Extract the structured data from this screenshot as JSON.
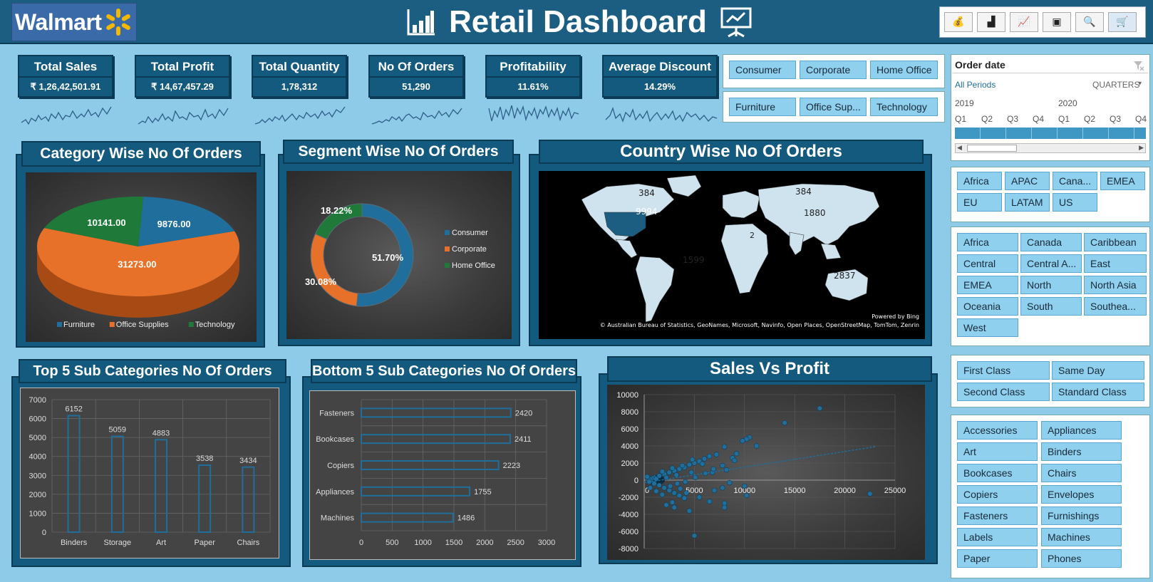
{
  "header": {
    "logo_text": "Walmart",
    "title": "Retail Dashboard",
    "toolbar": [
      "money-bag-icon",
      "chart-icon",
      "line-chart-icon",
      "box-icon",
      "search-icon",
      "cart-icon"
    ]
  },
  "kpis": [
    {
      "title": "Total Sales",
      "value": "₹ 1,26,42,501.91"
    },
    {
      "title": "Total Profit",
      "value": "₹ 14,67,457.29"
    },
    {
      "title": "Total Quantity",
      "value": "1,78,312"
    },
    {
      "title": "No Of Orders",
      "value": "51,290"
    },
    {
      "title": "Profitability",
      "value": "11.61%"
    },
    {
      "title": "Average Discount",
      "value": "14.29%"
    }
  ],
  "segment_slicer": [
    "Consumer",
    "Corporate",
    "Home Office"
  ],
  "category_slicer": [
    "Furniture",
    "Office Sup...",
    "Technology"
  ],
  "timeline": {
    "title": "Order date",
    "all_periods": "All Periods",
    "level": "QUARTERS",
    "years": [
      "2019",
      "2020"
    ],
    "quarters": [
      "Q1",
      "Q2",
      "Q3",
      "Q4",
      "Q1",
      "Q2",
      "Q3",
      "Q4"
    ]
  },
  "market_slicer": [
    "Africa",
    "APAC",
    "Cana...",
    "EMEA",
    "EU",
    "LATAM",
    "US"
  ],
  "region_slicer": [
    "Africa",
    "Canada",
    "Caribbean",
    "Central",
    "Central A...",
    "East",
    "EMEA",
    "North",
    "North Asia",
    "Oceania",
    "South",
    "Southea...",
    "West"
  ],
  "ship_slicer": [
    "First Class",
    "Same Day",
    "Second Class",
    "Standard Class"
  ],
  "subcat_slicer": [
    "Accessories",
    "Appliances",
    "Art",
    "Binders",
    "Bookcases",
    "Chairs",
    "Copiers",
    "Envelopes",
    "Fasteners",
    "Furnishings",
    "Labels",
    "Machines",
    "Paper",
    "Phones"
  ],
  "colors": {
    "furniture": "#1f6e9c",
    "office": "#e8712a",
    "technology": "#1f7a3a",
    "accent": "#135a7e",
    "bar": "#1f6e9c"
  },
  "chart_data": [
    {
      "type": "pie",
      "title": "Category Wise No Of Orders",
      "categories": [
        "Furniture",
        "Office Supplies",
        "Technology"
      ],
      "values": [
        9876,
        31273,
        10141
      ],
      "labels": [
        "9876.00",
        "31273.00",
        "10141.00"
      ],
      "legend": "bottom"
    },
    {
      "type": "pie",
      "title": "Segment Wise No Of Orders",
      "categories": [
        "Consumer",
        "Corporate",
        "Home Office"
      ],
      "values": [
        51.7,
        30.08,
        18.22
      ],
      "labels": [
        "51.70%",
        "30.08%",
        "18.22%"
      ],
      "legend": "right"
    },
    {
      "type": "map",
      "title": "Country Wise No Of Orders",
      "labels": [
        "384",
        "9994",
        "384",
        "1880",
        "1599",
        "2837",
        "2"
      ],
      "attribution": "© Australian Bureau of Statistics, GeoNames, Microsoft, Navinfo, Open Places, OpenStreetMap, TomTom, Zenrin",
      "powered": "Powered by Bing"
    },
    {
      "type": "bar",
      "title": "Top 5 Sub Categories No Of Orders",
      "categories": [
        "Binders",
        "Storage",
        "Art",
        "Paper",
        "Chairs"
      ],
      "values": [
        6152,
        5059,
        4883,
        3538,
        3434
      ],
      "ylim": [
        0,
        7000
      ],
      "yticks": [
        0,
        1000,
        2000,
        3000,
        4000,
        5000,
        6000,
        7000
      ],
      "grid": true
    },
    {
      "type": "bar",
      "orientation": "horizontal",
      "title": "Bottom 5 Sub Categories No Of Orders",
      "categories": [
        "Fasteners",
        "Bookcases",
        "Copiers",
        "Appliances",
        "Machines"
      ],
      "values": [
        2420,
        2411,
        2223,
        1755,
        1486
      ],
      "xlim": [
        0,
        3000
      ],
      "xticks": [
        0,
        500,
        1000,
        1500,
        2000,
        2500,
        3000
      ],
      "grid": true
    },
    {
      "type": "scatter",
      "title": "Sales Vs Profit",
      "xlim": [
        0,
        25000
      ],
      "ylim": [
        -8000,
        10000
      ],
      "xticks": [
        0,
        5000,
        10000,
        15000,
        20000,
        25000
      ],
      "yticks": [
        -8000,
        -6000,
        -4000,
        -2000,
        0,
        2000,
        4000,
        6000,
        8000,
        10000
      ],
      "points": [
        [
          17500,
          8400
        ],
        [
          14000,
          6700
        ],
        [
          10500,
          5000
        ],
        [
          10200,
          4800
        ],
        [
          9800,
          4600
        ],
        [
          11200,
          4000
        ],
        [
          8000,
          3900
        ],
        [
          9200,
          3100
        ],
        [
          7200,
          3000
        ],
        [
          6500,
          2800
        ],
        [
          8800,
          2600
        ],
        [
          9000,
          2300
        ],
        [
          6000,
          2500
        ],
        [
          5500,
          2200
        ],
        [
          5000,
          2000
        ],
        [
          4500,
          1800
        ],
        [
          7800,
          1700
        ],
        [
          8200,
          1200
        ],
        [
          4000,
          1500
        ],
        [
          3500,
          1300
        ],
        [
          3000,
          1100
        ],
        [
          2500,
          900
        ],
        [
          2000,
          700
        ],
        [
          1500,
          500
        ],
        [
          1000,
          300
        ],
        [
          800,
          200
        ],
        [
          600,
          100
        ],
        [
          400,
          50
        ],
        [
          300,
          400
        ],
        [
          1200,
          150
        ],
        [
          2200,
          300
        ],
        [
          3200,
          600
        ],
        [
          1800,
          1000
        ],
        [
          2800,
          1400
        ],
        [
          3800,
          1700
        ],
        [
          4800,
          2400
        ],
        [
          5800,
          1900
        ],
        [
          6800,
          900
        ],
        [
          500,
          -200
        ],
        [
          1000,
          -400
        ],
        [
          1500,
          -600
        ],
        [
          2000,
          -900
        ],
        [
          2500,
          -1200
        ],
        [
          3000,
          -1500
        ],
        [
          3500,
          -1800
        ],
        [
          4000,
          -2100
        ],
        [
          2800,
          -2600
        ],
        [
          2200,
          -2900
        ],
        [
          5500,
          -2000
        ],
        [
          7000,
          -1200
        ],
        [
          7800,
          -900
        ],
        [
          8500,
          -300
        ],
        [
          10000,
          -700
        ],
        [
          10200,
          -1800
        ],
        [
          8000,
          -2700
        ],
        [
          6500,
          -2500
        ],
        [
          8000,
          -3200
        ],
        [
          4500,
          -3600
        ],
        [
          3000,
          -3200
        ],
        [
          5000,
          -6500
        ],
        [
          22500,
          -1600
        ],
        [
          4200,
          -1500
        ],
        [
          3600,
          -1000
        ],
        [
          1200,
          -1300
        ],
        [
          1800,
          -1700
        ],
        [
          600,
          -900
        ],
        [
          2600,
          -700
        ],
        [
          3300,
          -400
        ],
        [
          4100,
          -200
        ],
        [
          5100,
          300
        ],
        [
          6100,
          800
        ],
        [
          6900,
          1300
        ],
        [
          4700,
          900
        ]
      ],
      "trendline": true
    }
  ]
}
